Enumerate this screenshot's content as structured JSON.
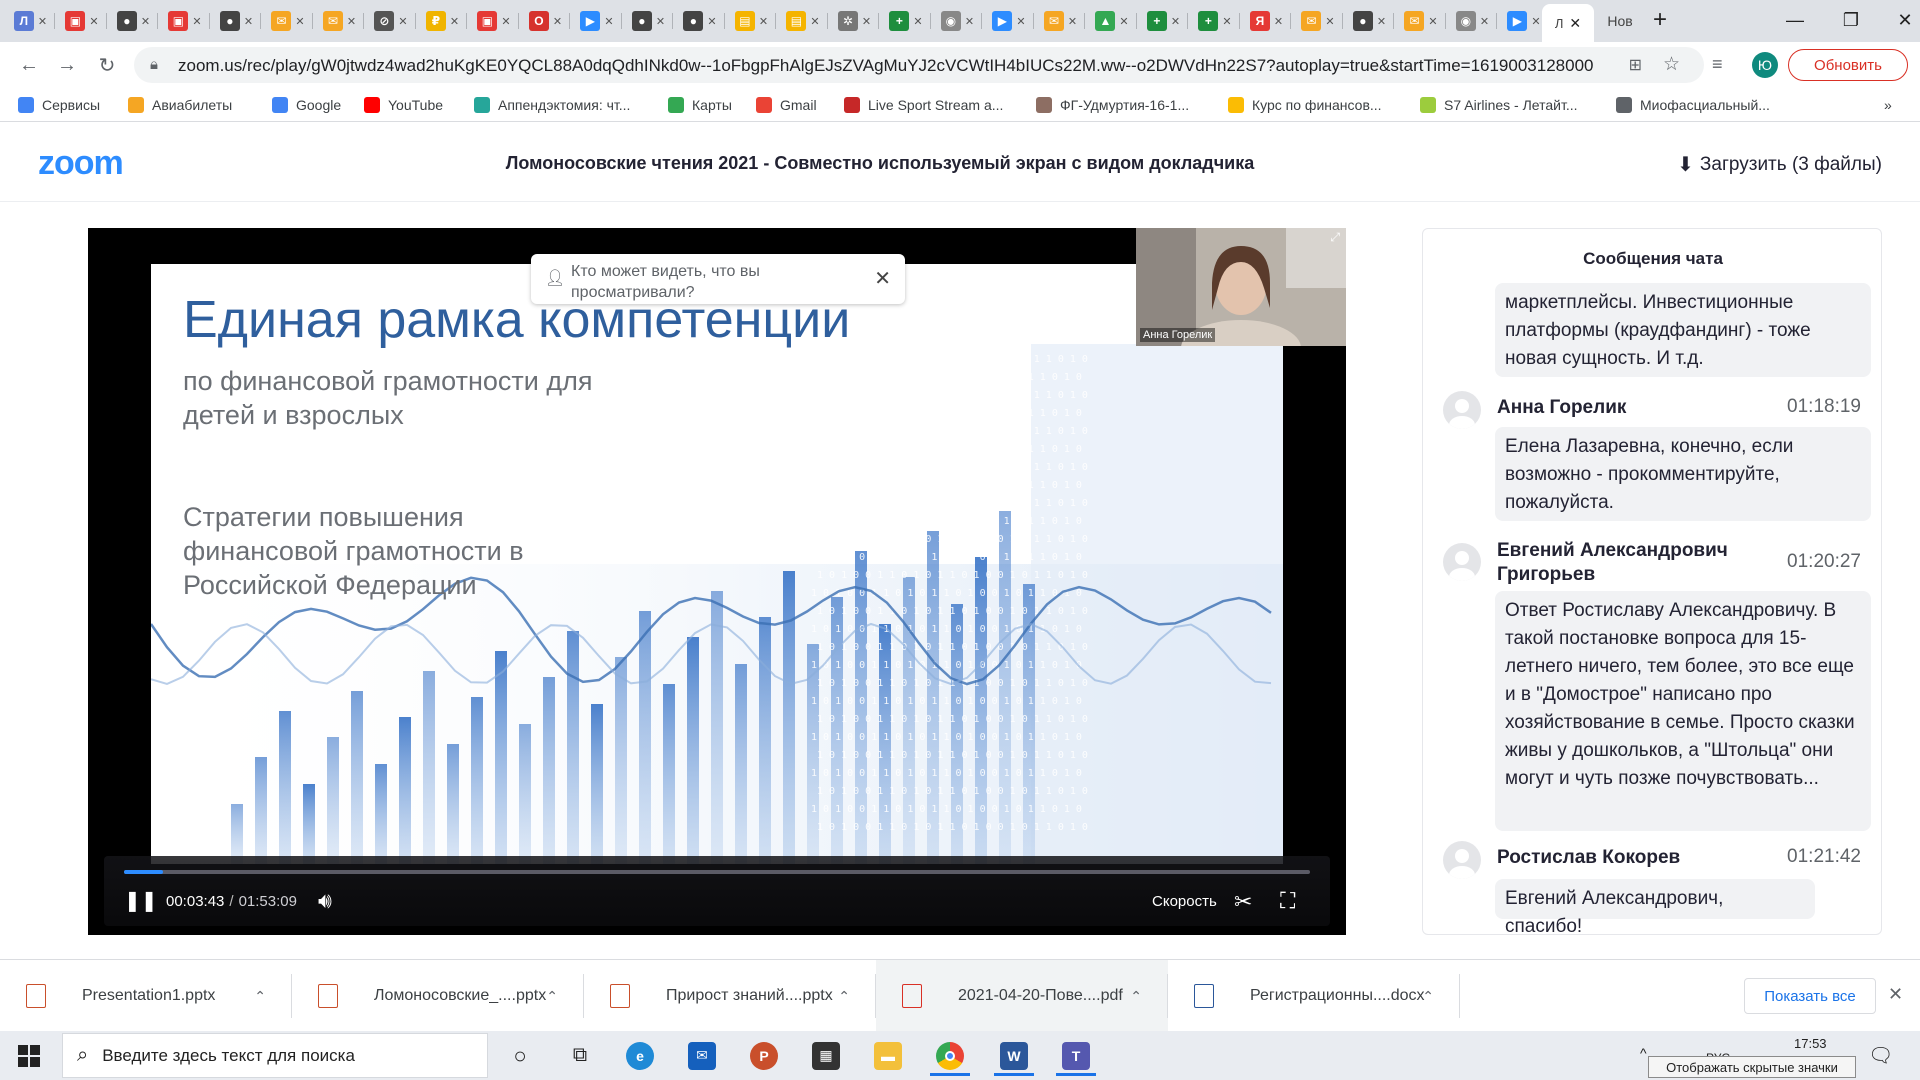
{
  "browser": {
    "tabs": [
      {
        "icon": "l-letter-icon",
        "color": "#5b7bd5",
        "glyph": "Л"
      },
      {
        "icon": "pdf-icon",
        "color": "#e53935",
        "glyph": "▣"
      },
      {
        "icon": "github-icon",
        "color": "#444444",
        "glyph": "●"
      },
      {
        "icon": "pdf-icon",
        "color": "#e53935",
        "glyph": "▣"
      },
      {
        "icon": "github-icon",
        "color": "#444444",
        "glyph": "●"
      },
      {
        "icon": "mail-icon",
        "color": "#f5a623",
        "glyph": "✉"
      },
      {
        "icon": "mail-icon",
        "color": "#f5a623",
        "glyph": "✉"
      },
      {
        "icon": "compass-icon",
        "color": "#555555",
        "glyph": "⊘"
      },
      {
        "icon": "coin-icon",
        "color": "#f0b400",
        "glyph": "₽"
      },
      {
        "icon": "pdf-icon",
        "color": "#e53935",
        "glyph": "▣"
      },
      {
        "icon": "opera-icon",
        "color": "#d6322d",
        "glyph": "O"
      },
      {
        "icon": "zoom-icon",
        "color": "#2d8cff",
        "glyph": "▶"
      },
      {
        "icon": "github-icon",
        "color": "#444444",
        "glyph": "●"
      },
      {
        "icon": "github-icon",
        "color": "#444444",
        "glyph": "●"
      },
      {
        "icon": "book-icon",
        "color": "#f5b400",
        "glyph": "▤"
      },
      {
        "icon": "book-icon",
        "color": "#f5b400",
        "glyph": "▤"
      },
      {
        "icon": "puzzle-icon",
        "color": "#777777",
        "glyph": "✲"
      },
      {
        "icon": "plus-green-icon",
        "color": "#1e8e3e",
        "glyph": "+"
      },
      {
        "icon": "disk-icon",
        "color": "#888888",
        "glyph": "◉"
      },
      {
        "icon": "zoom-icon",
        "color": "#2d8cff",
        "glyph": "▶"
      },
      {
        "icon": "mail-icon",
        "color": "#f5a623",
        "glyph": "✉"
      },
      {
        "icon": "drive-icon",
        "color": "#34a853",
        "glyph": "▲"
      },
      {
        "icon": "plus-green-icon",
        "color": "#1e8e3e",
        "glyph": "+"
      },
      {
        "icon": "plus-green-icon",
        "color": "#1e8e3e",
        "glyph": "+"
      },
      {
        "icon": "yandex-icon",
        "color": "#e53935",
        "glyph": "Я"
      },
      {
        "icon": "mail-icon",
        "color": "#f5a623",
        "glyph": "✉"
      },
      {
        "icon": "github-icon",
        "color": "#444444",
        "glyph": "●"
      },
      {
        "icon": "mail-icon",
        "color": "#f5a623",
        "glyph": "✉"
      },
      {
        "icon": "disk-icon",
        "color": "#888888",
        "glyph": "◉"
      },
      {
        "icon": "zoom-icon",
        "color": "#2d8cff",
        "glyph": "▶"
      }
    ],
    "active_tab_label": "Л",
    "new_tab_label": "Нов",
    "url": "zoom.us/rec/play/gW0jtwdz4wad2huKgKE0YQCL88A0dqQdhINkd0w--1oFbgpFhAlgEJsZVAgMuYJ2cVCWtIH4bIUCs22M.ww--o2DWVdHn22S7?autoplay=true&startTime=1619003128000",
    "profile_initial": "Ю",
    "update_label": "Обновить",
    "bookmarks": [
      {
        "label": "Сервисы",
        "icon": "apps-grid-icon",
        "color": "#4285f4"
      },
      {
        "label": "Авиабилеты",
        "icon": "plane-icon",
        "color": "#f5a623"
      },
      {
        "label": "Google",
        "icon": "google-icon",
        "color": "#4285f4"
      },
      {
        "label": "YouTube",
        "icon": "youtube-icon",
        "color": "#ff0000"
      },
      {
        "label": "Аппендэктомия: чт...",
        "icon": "heart-icon",
        "color": "#26a69a"
      },
      {
        "label": "Карты",
        "icon": "maps-pin-icon",
        "color": "#34a853"
      },
      {
        "label": "Gmail",
        "icon": "gmail-icon",
        "color": "#ea4335"
      },
      {
        "label": "Live Sport Stream a...",
        "icon": "sport-icon",
        "color": "#c62828"
      },
      {
        "label": "ФГ-Удмуртия-16-1...",
        "icon": "building-icon",
        "color": "#8d6e63"
      },
      {
        "label": "Курс по финансов...",
        "icon": "drive-icon",
        "color": "#fbbc04"
      },
      {
        "label": "S7 Airlines - Летайт...",
        "icon": "s7-icon",
        "color": "#9ccc3d"
      },
      {
        "label": "Миофасциальный...",
        "icon": "headset-icon",
        "color": "#5f6368"
      }
    ]
  },
  "zoom": {
    "logo": "zoom",
    "title": "Ломоносовские чтения 2021 - Совместно используемый экран с видом докладчика",
    "download_label": "Загрузить (3 файлы)"
  },
  "player": {
    "slide_title": "Единая рамка компетенции",
    "slide_subtitle": "по финансовой грамотности для детей и взрослых",
    "slide_strategy": "Стратегии повышения финансовой грамотности в Российской Федерации",
    "popup_text": "Кто может видеть, что вы просматривали?",
    "speaker_name": "Анна Горелик",
    "current_time": "00:03:43",
    "time_separator": "/",
    "total_time": "01:53:09",
    "progress_fraction": 0.033,
    "speed_label": "Скорость"
  },
  "chat": {
    "title": "Сообщения чата",
    "messages": [
      {
        "sender": "",
        "time": "",
        "text": "маркетплейсы. Инвестиционные платформы (краудфандинг) - тоже новая сущность. И т.д."
      },
      {
        "sender": "Анна Горелик",
        "time": "01:18:19",
        "text": "Елена Лазаревна, конечно, если возможно - прокомментируйте, пожалуйста."
      },
      {
        "sender": "Евгений Александрович Григорьев",
        "time": "01:20:27",
        "text": "Ответ Ростиславу Александровичу. В такой постановке вопроса для 15-летнего ничего, тем более, это все еще и в \"Домострое\" написано про хозяйствование в семье. Просто сказки живы у дошкольков, а \"Штольца\" они могут и чуть позже почувствовать..."
      },
      {
        "sender": "Ростислав Кокорев",
        "time": "01:21:42",
        "text": "Евгений Александрович, спасибо!"
      }
    ]
  },
  "downloads": {
    "items": [
      {
        "name": "Presentation1.pptx",
        "type": "pptx"
      },
      {
        "name": "Ломоносовские_....pptx",
        "type": "pptx"
      },
      {
        "name": "Прирост знаний....pptx",
        "type": "pptx"
      },
      {
        "name": "2021-04-20-Пове....pdf",
        "type": "pdf"
      },
      {
        "name": "Регистрационны....docx",
        "type": "docx"
      }
    ],
    "show_all_label": "Показать все"
  },
  "taskbar": {
    "search_placeholder": "Введите здесь текст для поиска",
    "time": "17:53",
    "lang": "РУС",
    "tooltip": "Отображать скрытые значки"
  }
}
